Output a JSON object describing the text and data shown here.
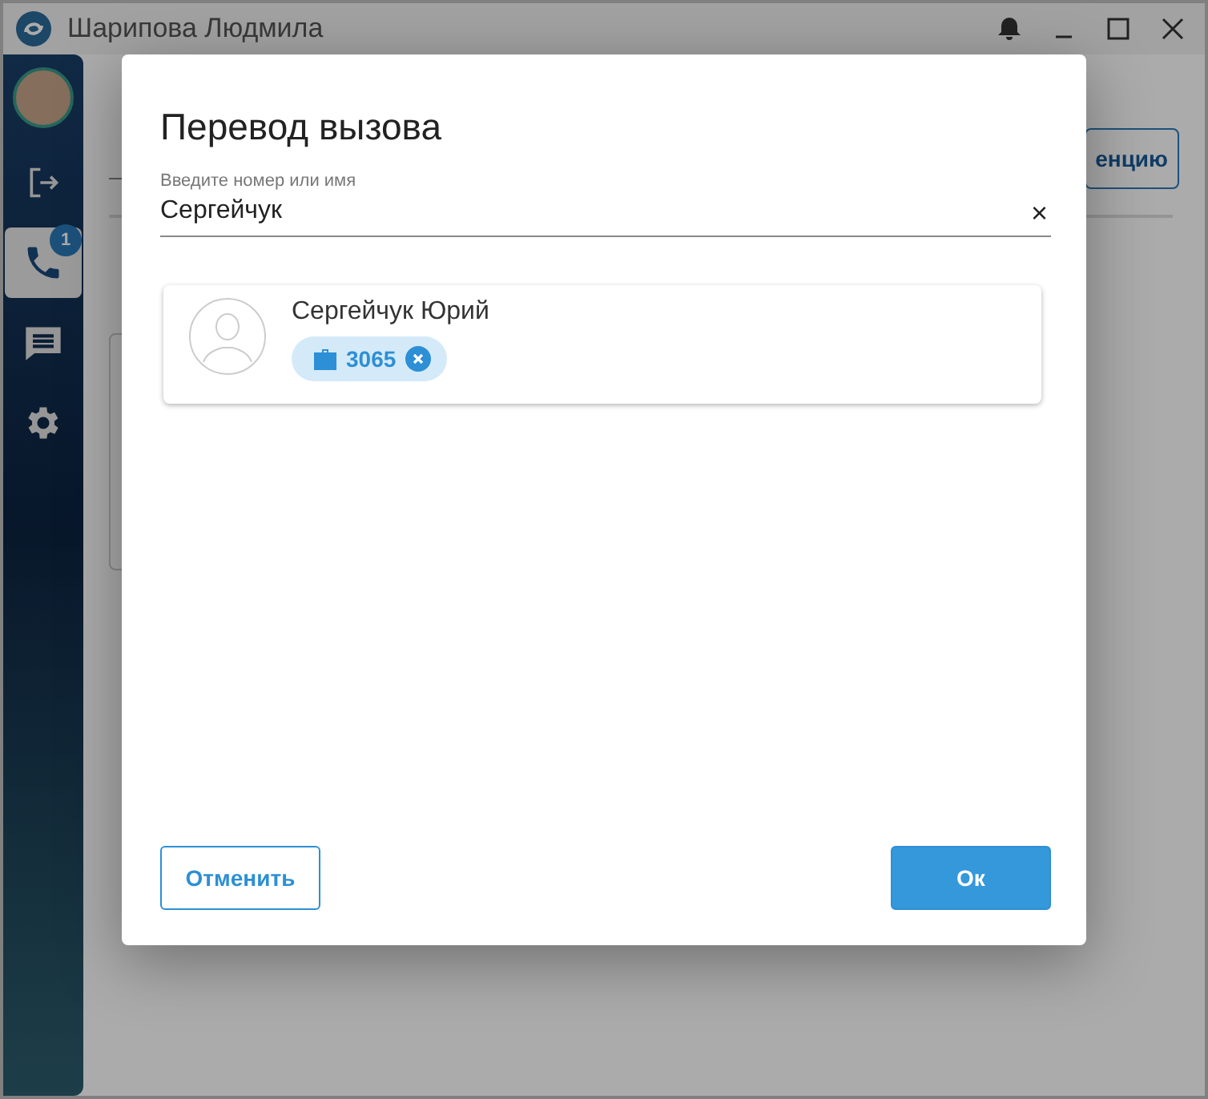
{
  "window": {
    "title": "Шарипова Людмила"
  },
  "sidebar": {
    "items": [
      {
        "kind": "logout",
        "selected": false
      },
      {
        "kind": "calls",
        "selected": true,
        "badge": "1"
      },
      {
        "kind": "chat",
        "selected": false
      },
      {
        "kind": "settings",
        "selected": false
      }
    ]
  },
  "background": {
    "button_label": "енцию"
  },
  "dialog": {
    "title": "Перевод вызова",
    "search": {
      "label": "Введите номер или имя",
      "value": "Сергейчук",
      "clear": "×"
    },
    "results": [
      {
        "name": "Сергейчук Юрий",
        "phones": [
          {
            "kind": "work",
            "number": "3065"
          }
        ]
      }
    ],
    "buttons": [
      {
        "kind": "outlined",
        "label": "Отменить"
      },
      {
        "kind": "filled",
        "label": "Ок"
      }
    ]
  }
}
